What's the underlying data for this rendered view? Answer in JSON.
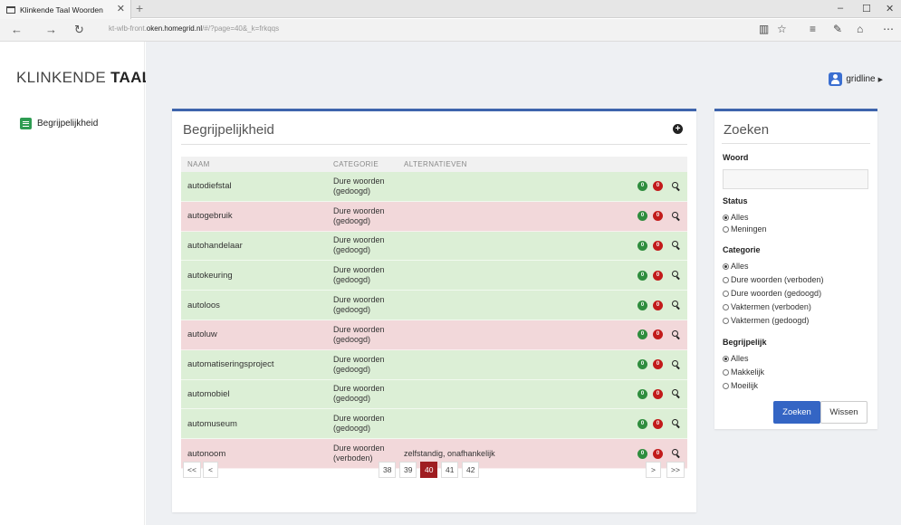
{
  "browser": {
    "tab_title": "Klinkende Taal Woorden",
    "tab_close": "✕",
    "new_tab": "+",
    "url_prefix": "kt-wlb-front.",
    "url_host": "oken.homegrid.nl",
    "url_path": "/#/?page=40&_k=frkqqs",
    "minimize": "–",
    "maximize": "☐",
    "close": "✕"
  },
  "app": {
    "logo_light": "KLINKENDE ",
    "logo_bold": "TAAL",
    "sidebar": {
      "items": [
        {
          "label": "Begrijpelijkheid",
          "icon": "list-icon"
        }
      ]
    },
    "user": {
      "name": "gridline"
    }
  },
  "panel": {
    "title": "Begrijpelijkheid",
    "columns": {
      "name": "NAAM",
      "category": "CATEGORIE",
      "alternatives": "ALTERNATIEVEN"
    },
    "rows": [
      {
        "name": "autodiefstal",
        "cat1": "Dure woorden",
        "cat2": "(gedoogd)",
        "alt": "",
        "status": "green"
      },
      {
        "name": "autogebruik",
        "cat1": "Dure woorden",
        "cat2": "(gedoogd)",
        "alt": "",
        "status": "red"
      },
      {
        "name": "autohandelaar",
        "cat1": "Dure woorden",
        "cat2": "(gedoogd)",
        "alt": "",
        "status": "green"
      },
      {
        "name": "autokeuring",
        "cat1": "Dure woorden",
        "cat2": "(gedoogd)",
        "alt": "",
        "status": "green"
      },
      {
        "name": "autoloos",
        "cat1": "Dure woorden",
        "cat2": "(gedoogd)",
        "alt": "",
        "status": "green"
      },
      {
        "name": "autoluw",
        "cat1": "Dure woorden",
        "cat2": "(gedoogd)",
        "alt": "",
        "status": "red"
      },
      {
        "name": "automatiseringsproject",
        "cat1": "Dure woorden",
        "cat2": "(gedoogd)",
        "alt": "",
        "status": "green"
      },
      {
        "name": "automobiel",
        "cat1": "Dure woorden",
        "cat2": "(gedoogd)",
        "alt": "",
        "status": "green"
      },
      {
        "name": "automuseum",
        "cat1": "Dure woorden",
        "cat2": "(gedoogd)",
        "alt": "",
        "status": "green"
      },
      {
        "name": "autonoom",
        "cat1": "Dure woorden",
        "cat2": "(verboden)",
        "alt": "zelfstandig, onafhankelijk",
        "status": "red"
      }
    ],
    "pager": {
      "first": "<<",
      "prev": "<",
      "pages": [
        "38",
        "39",
        "40",
        "41",
        "42"
      ],
      "active": "40",
      "next": ">",
      "last": ">>"
    }
  },
  "search": {
    "title": "Zoeken",
    "word_label": "Woord",
    "status_label": "Status",
    "status_options": [
      "Alles",
      "Meningen"
    ],
    "category_label": "Categorie",
    "category_options": [
      "Alles",
      "Dure woorden (verboden)",
      "Dure woorden (gedoogd)",
      "Vaktermen (verboden)",
      "Vaktermen (gedoogd)"
    ],
    "clear_label": "Begrijpelijk",
    "clear_options": [
      "Alles",
      "Makkelijk",
      "Moeilijk"
    ],
    "submit": "Zoeken",
    "reset": "Wissen"
  },
  "colors": {
    "accent": "#3e64ac",
    "row_green": "#dcefd6",
    "row_red": "#f2d8da",
    "page_active": "#9f1d21",
    "button_primary": "#3465c4"
  }
}
